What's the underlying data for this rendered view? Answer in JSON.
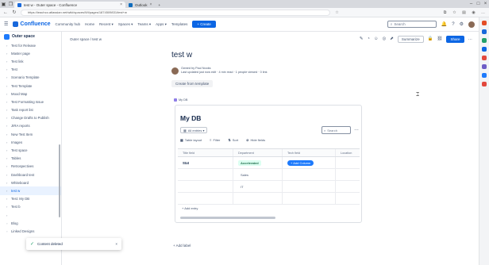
{
  "browser": {
    "tabs": [
      {
        "label": "test w - Outer space - Confluence",
        "active": true
      },
      {
        "label": "Outlook",
        "active": false
      }
    ],
    "url": "https://ieachco.atlassian.net/wiki/spaces/Wi/pages/1874509831/test+w",
    "rail_colors": [
      "#e44d26",
      "#1868db",
      "#22a06b",
      "#0c66e4",
      "#e2483d",
      "#6e5dc6",
      "#1d7afc",
      "#e2483d"
    ]
  },
  "topnav": {
    "logo": "Confluence",
    "links": [
      "Community hub",
      "Home",
      "Recent ▾",
      "Spaces ▾",
      "Teams ▾",
      "Apps ▾",
      "Templates"
    ],
    "create": "+ Create",
    "search_placeholder": "Search"
  },
  "sidebar": {
    "space_name": "Outer space",
    "items": [
      {
        "label": "Test for Release",
        "chev": true
      },
      {
        "label": "Master page",
        "chev": true
      },
      {
        "label": "Test link",
        "chev": true
      },
      {
        "label": "Test",
        "chev": true
      },
      {
        "label": "Scenario Template",
        "chev": true
      },
      {
        "label": "Test Template",
        "chev": true
      },
      {
        "label": "Mood Map",
        "chev": true
      },
      {
        "label": "Test Formatting Issue",
        "chev": true
      },
      {
        "label": "Task report list",
        "chev": true
      },
      {
        "label": "Change Drafts to Publish",
        "chev": true
      },
      {
        "label": "JIRA reports",
        "chev": true
      },
      {
        "label": "New Test Item",
        "chev": true
      },
      {
        "label": "Images",
        "chev": true
      },
      {
        "label": "Test space",
        "chev": true
      },
      {
        "label": "Tables",
        "chev": true
      },
      {
        "label": "Retrospectives",
        "chev": true
      },
      {
        "label": "Dashboard test",
        "chev": true
      },
      {
        "label": "Whiteboard",
        "chev": true
      },
      {
        "label": "test w",
        "chev": true,
        "active": true
      },
      {
        "label": "Test: My DB",
        "chev": true
      },
      {
        "label": "Test b",
        "chev": true
      },
      {
        "label": "",
        "chev": true
      },
      {
        "label": "Blog",
        "chev": false
      },
      {
        "label": "Linked Designs",
        "chev": false
      }
    ]
  },
  "toast": {
    "message": "Content deleted"
  },
  "breadcrumb": "Outer space / test w",
  "page_actions": {
    "summarize": "Summarize",
    "share": "Share"
  },
  "page": {
    "title": "test w",
    "author": "Owned by Paul Nooks",
    "meta": "Last updated just now edit · 4 min read · 1 people viewed · 0 link",
    "from_template": "Create from template",
    "db_tag": "My DB",
    "add_label": "+ Add label"
  },
  "db": {
    "title": "My DB",
    "view": "All entries ▾",
    "search_placeholder": "Search",
    "toolbar": [
      "Table layout",
      "Filter",
      "Sort",
      "Hide fields"
    ],
    "columns": [
      "Title field",
      "Department",
      "Tech field",
      "Location"
    ],
    "rows": [
      {
        "title": "Stat",
        "department": "Accelerated",
        "tech": "+ Add Column",
        "location": ""
      },
      {
        "title": "",
        "department": "Sales",
        "tech": "",
        "location": ""
      },
      {
        "title": "",
        "department": "IT",
        "tech": "",
        "location": ""
      },
      {
        "title": "",
        "department": "",
        "tech": "",
        "location": ""
      }
    ],
    "add_entry": "+ Add entry"
  }
}
